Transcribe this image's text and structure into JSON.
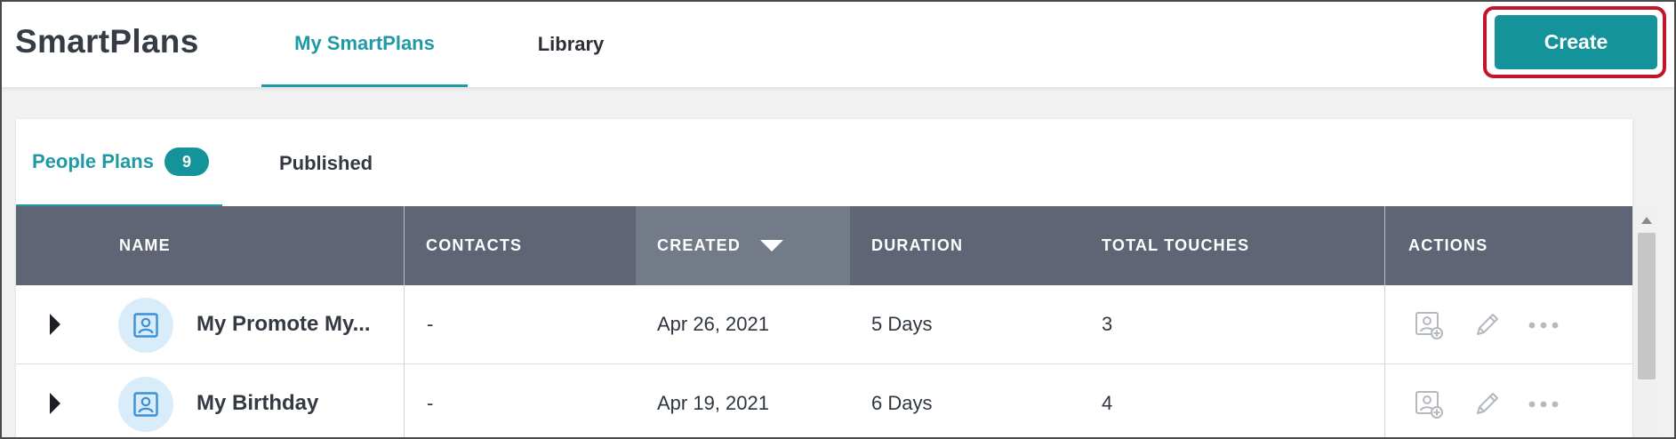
{
  "app": {
    "title": "SmartPlans"
  },
  "top_tabs": [
    {
      "label": "My SmartPlans",
      "active": true
    },
    {
      "label": "Library",
      "active": false
    }
  ],
  "create_button": {
    "label": "Create",
    "color": "#14939b",
    "highlight_color": "#c4142c"
  },
  "sub_tabs": [
    {
      "label": "People Plans",
      "count": "9",
      "active": true
    },
    {
      "label": "Published",
      "active": false
    }
  ],
  "table": {
    "columns": [
      "NAME",
      "CONTACTS",
      "CREATED",
      "DURATION",
      "TOTAL TOUCHES",
      "ACTIONS"
    ],
    "sorted_column": "CREATED",
    "sort_direction": "desc",
    "rows": [
      {
        "name": "My Promote My...",
        "contacts": "-",
        "created": "Apr 26, 2021",
        "duration": "5 Days",
        "total_touches": "3",
        "icon": "person-card-icon"
      },
      {
        "name": "My Birthday",
        "contacts": "-",
        "created": "Apr 19, 2021",
        "duration": "6 Days",
        "total_touches": "4",
        "icon": "person-card-icon"
      }
    ],
    "row_actions": [
      "add-contact-icon",
      "edit-pencil-icon",
      "more-options-icon"
    ]
  },
  "colors": {
    "accent": "#1f9aa5",
    "header_bg": "#5f6575",
    "sorted_header_bg": "#737a88",
    "avatar_bg": "#d8ecfa",
    "avatar_icon": "#3d8fd6"
  }
}
